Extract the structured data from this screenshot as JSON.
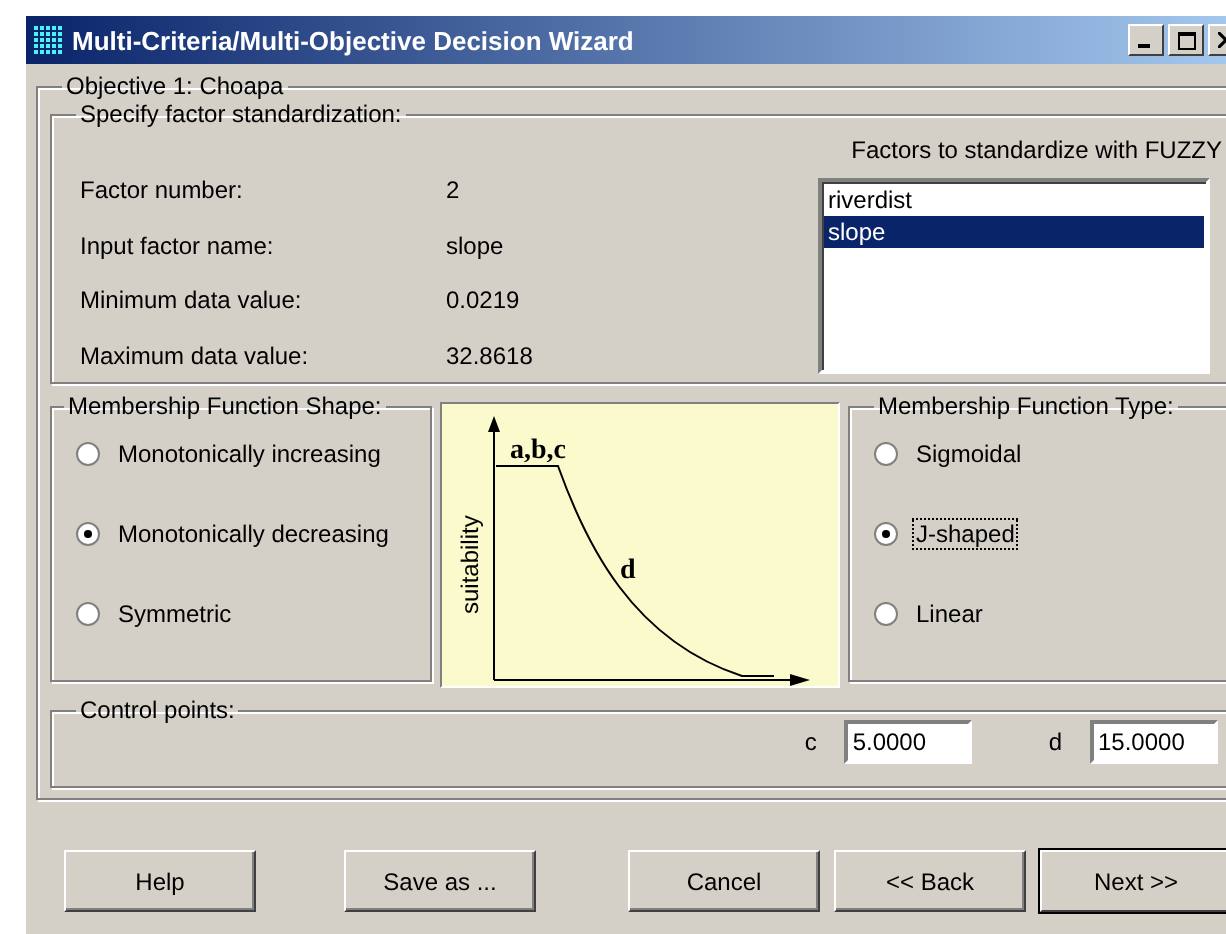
{
  "window": {
    "title": "Multi-Criteria/Multi-Objective Decision Wizard"
  },
  "objective": {
    "title": "Objective 1: Choapa"
  },
  "factor": {
    "title": "Specify factor standardization:",
    "fields": [
      {
        "label": "Factor number:",
        "value": "2"
      },
      {
        "label": "Input factor name:",
        "value": "slope"
      },
      {
        "label": "Minimum data value:",
        "value": "0.0219"
      },
      {
        "label": "Maximum data value:",
        "value": "32.8618"
      }
    ],
    "list": {
      "title": "Factors to standardize with FUZZY",
      "items": [
        {
          "label": "riverdist",
          "selected": false
        },
        {
          "label": "slope",
          "selected": true
        }
      ]
    }
  },
  "shape": {
    "title": "Membership Function Shape:",
    "options": [
      {
        "label": "Monotonically increasing",
        "selected": false
      },
      {
        "label": "Monotonically decreasing",
        "selected": true
      },
      {
        "label": "Symmetric",
        "selected": false
      }
    ]
  },
  "diagram": {
    "ylabel": "suitability",
    "top_label": "a,b,c",
    "curve_label": "d"
  },
  "type": {
    "title": "Membership Function Type:",
    "options": [
      {
        "label": "Sigmoidal",
        "selected": false,
        "focused": false
      },
      {
        "label": "J-shaped",
        "selected": true,
        "focused": true
      },
      {
        "label": "Linear",
        "selected": false,
        "focused": false
      }
    ]
  },
  "control_points": {
    "title": "Control points:",
    "fields": [
      {
        "label": "c",
        "value": "5.0000"
      },
      {
        "label": "d",
        "value": "15.0000"
      }
    ]
  },
  "buttons": [
    {
      "label": "Help",
      "default": false
    },
    {
      "label": "Save as ...",
      "default": false
    },
    {
      "label": "Cancel",
      "default": false
    },
    {
      "label": "<< Back",
      "default": false
    },
    {
      "label": "Next >>",
      "default": true
    }
  ]
}
